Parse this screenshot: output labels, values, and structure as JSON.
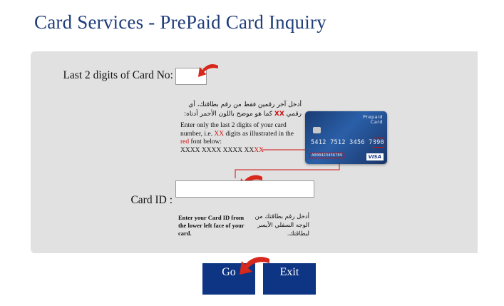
{
  "page": {
    "title": "Card Services - PrePaid Card Inquiry"
  },
  "form": {
    "digits_label": "Last 2 digits of Card No:",
    "digits_value": "",
    "arabic_help_pre": "أدخل آخر رقمين فقط من رقم بطاقتك، أي رقمي ",
    "arabic_help_xx": "XX",
    "arabic_help_post": " كما هو موضح باللون الأحمر أدناه:",
    "english_help_1": "Enter only the last 2 digits of your card number, i.e. ",
    "english_help_xx": "XX",
    "english_help_2": " digits as illustrated in the ",
    "english_help_red": "red",
    "english_help_3": " font below:",
    "mask_prefix": "XXXX XXXX XXXX XX",
    "mask_suffix": "XX",
    "card_id_label": "Card ID :",
    "card_id_value": "",
    "card_id_help_en": "Enter your Card ID from the lower left face of your card.",
    "card_id_help_ar": "أدخل رقم بطاقتك من الوجه السفلي الأيسر لبطاقتك."
  },
  "card_image": {
    "brand_line1": "Prepaid",
    "brand_line2": "Card",
    "number": "5412 7512 3456 7890",
    "card_id": "A000423456789",
    "network": "VISA"
  },
  "buttons": {
    "go": "Go",
    "exit": "Exit"
  },
  "colors": {
    "title": "#1f3d7a",
    "panel": "#e1e1e1",
    "button": "#0e3583",
    "highlight": "#d01010",
    "arrow": "#d8281c"
  }
}
